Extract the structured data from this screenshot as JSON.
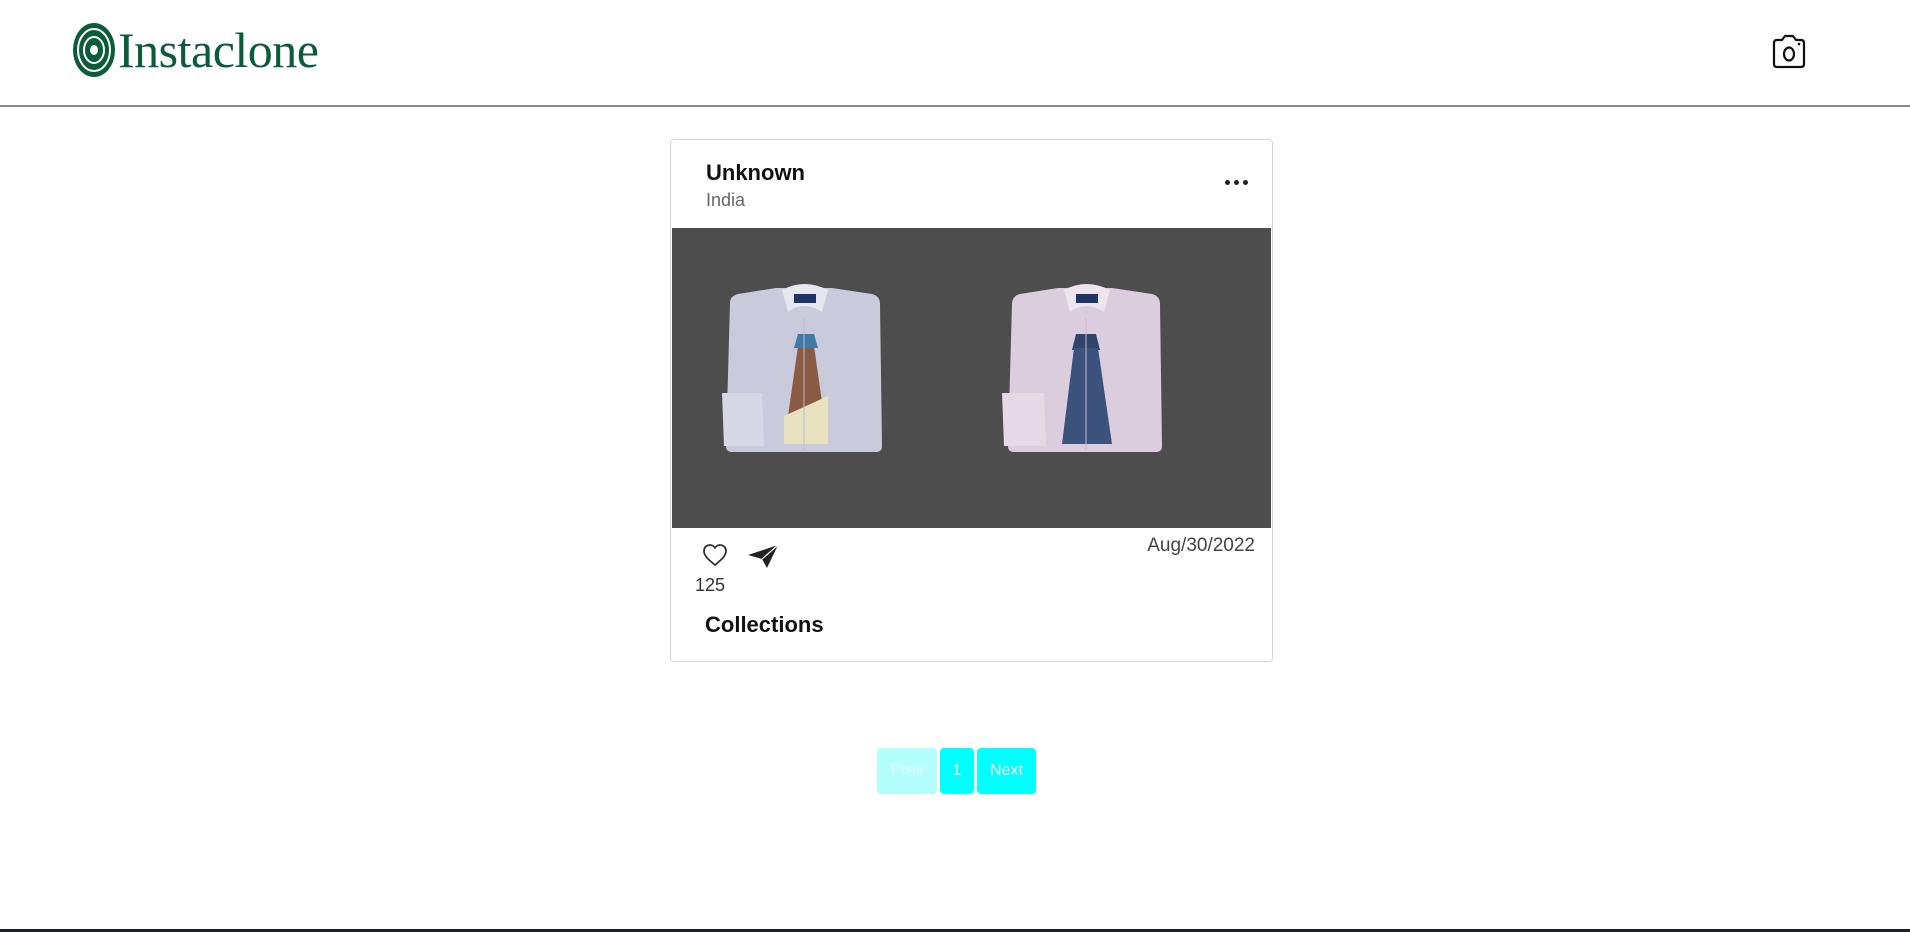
{
  "app": {
    "name": "Instaclone",
    "brand_color": "#0c5b3a",
    "header_icons": {
      "camera": "camera-icon"
    }
  },
  "post": {
    "author": "Unknown",
    "location": "India",
    "image_alt": "two shirts with ties",
    "likes": "125",
    "date": "Aug/30/2022",
    "description": "Collections",
    "icons": {
      "more": "more-options-icon",
      "like": "heart-icon",
      "share": "paper-plane-icon"
    }
  },
  "pagination": {
    "prev_label": "Prev",
    "current_page": "1",
    "next_label": "Next",
    "active_color": "#00ffff",
    "disabled_color": "#b3ffff"
  }
}
